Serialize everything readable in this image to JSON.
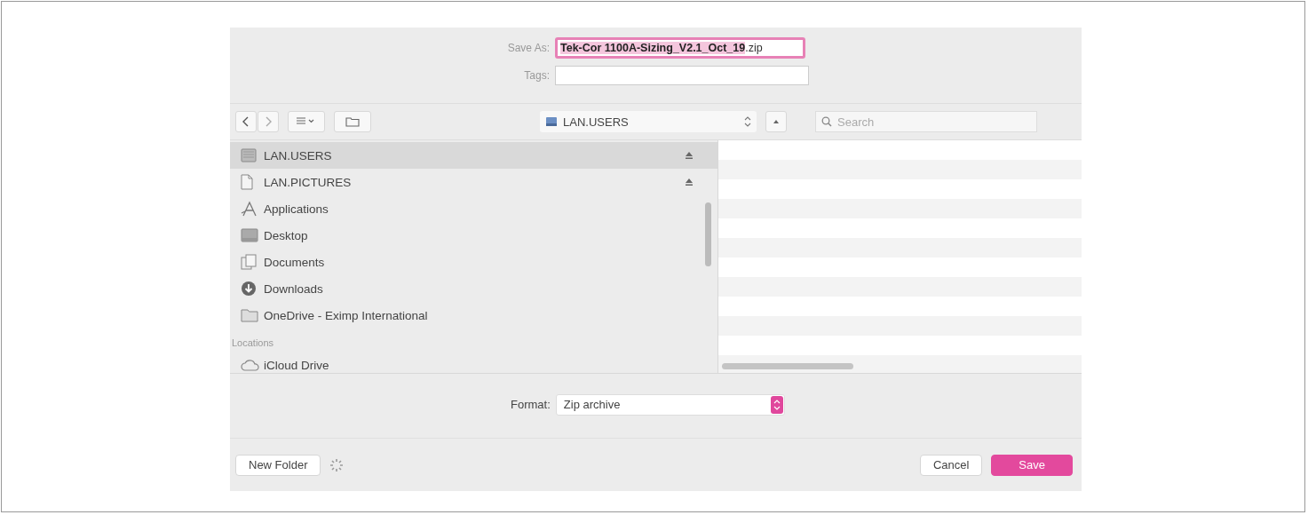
{
  "save_as": {
    "label": "Save As:",
    "value": "**Tek-Cor 1100A-Sizing_V2.1_Oct_19**.zip"
  },
  "tags": {
    "label": "Tags:"
  },
  "toolbar": {
    "location": "LAN.USERS",
    "search": {
      "placeholder": "Search"
    }
  },
  "sidebar": {
    "items": [
      {
        "label": "LAN.USERS",
        "kind": "drive",
        "eject": true,
        "selected": true
      },
      {
        "label": "LAN.PICTURES",
        "kind": "file",
        "eject": true,
        "selected": false
      },
      {
        "label": "Applications",
        "kind": "apps",
        "eject": false,
        "selected": false
      },
      {
        "label": "Desktop",
        "kind": "desktop",
        "eject": false,
        "selected": false
      },
      {
        "label": "Documents",
        "kind": "documents",
        "eject": false,
        "selected": false
      },
      {
        "label": "Downloads",
        "kind": "downloads",
        "eject": false,
        "selected": false
      },
      {
        "label": "OneDrive - Eximp International",
        "kind": "folder",
        "eject": false,
        "selected": false
      }
    ],
    "locations": {
      "header": "Locations",
      "items": [
        {
          "label": "iCloud Drive",
          "kind": "cloud",
          "selected": false
        }
      ]
    }
  },
  "format": {
    "label": "Format:",
    "value": "Zip archive"
  },
  "buttons": {
    "new_folder": "New Folder",
    "cancel": "Cancel",
    "save": "Save"
  }
}
